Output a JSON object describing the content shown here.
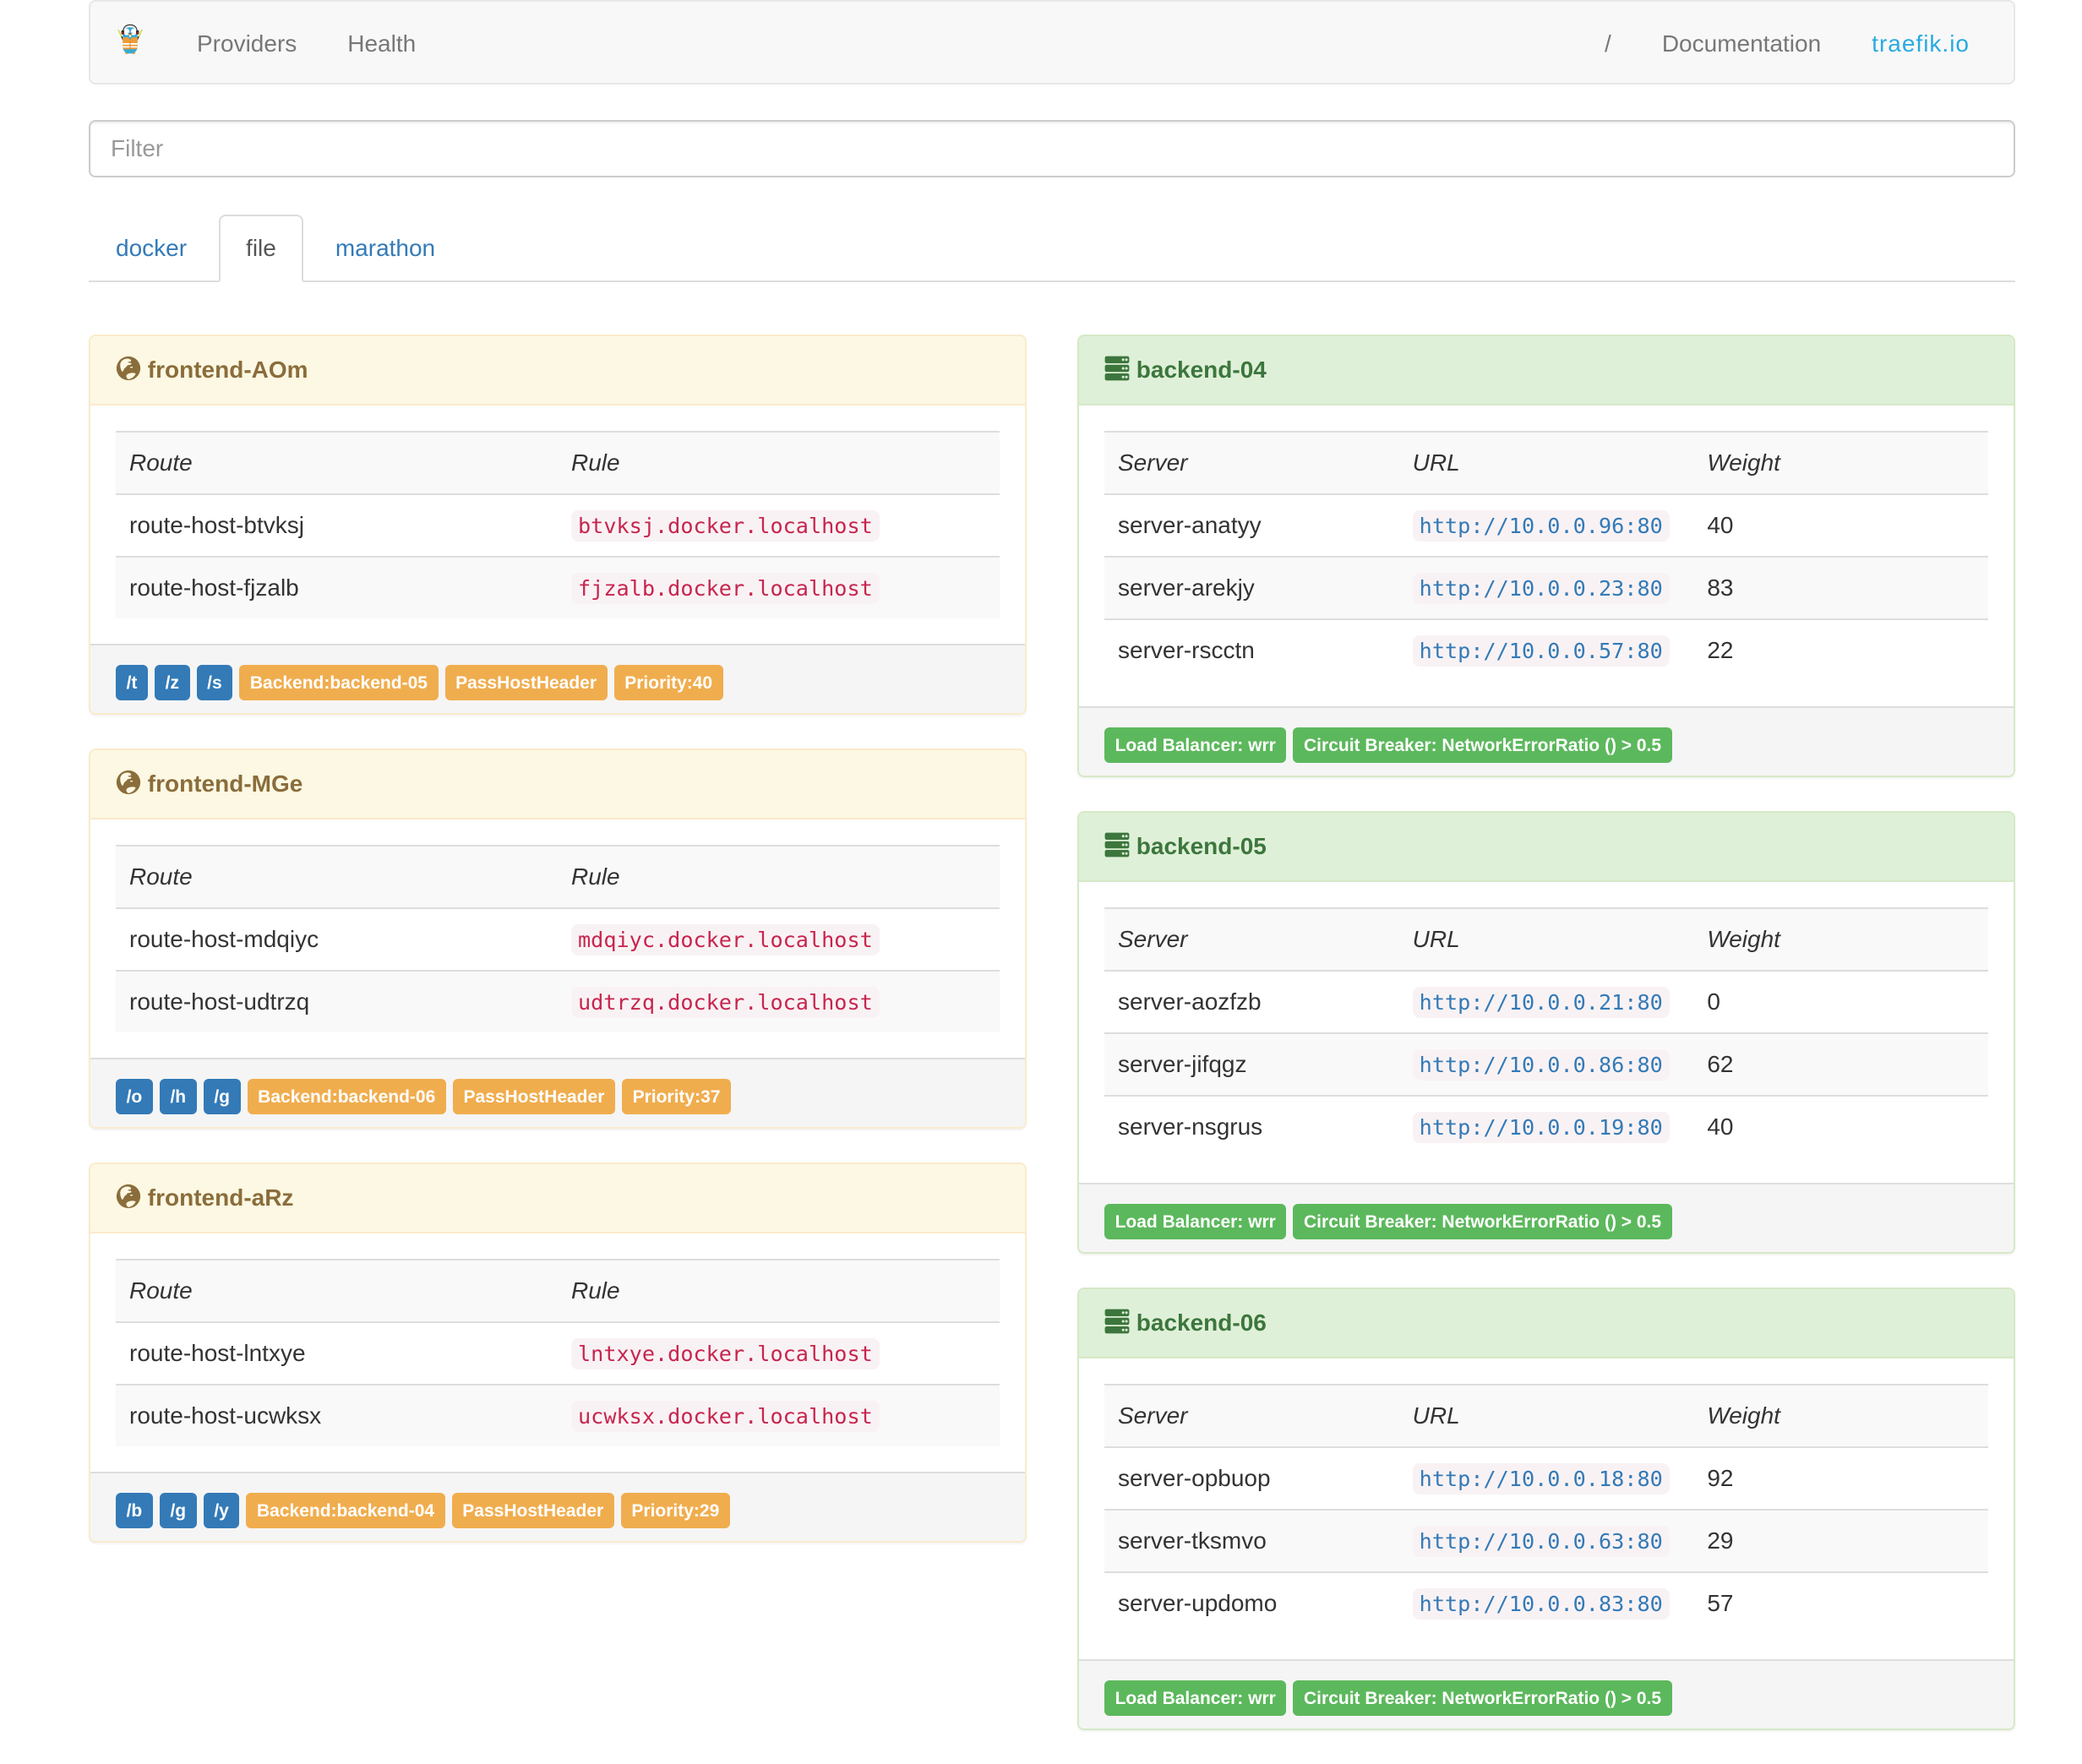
{
  "navbar": {
    "brand_icon": "traefik-gopher-logo",
    "left": [
      "Providers",
      "Health"
    ],
    "right": [
      "/",
      "Documentation",
      "traefik.io"
    ]
  },
  "filter": {
    "placeholder": "Filter"
  },
  "tabs": [
    {
      "label": "docker",
      "active": false
    },
    {
      "label": "file",
      "active": true
    },
    {
      "label": "marathon",
      "active": false
    }
  ],
  "frontend_columns": [
    "Route",
    "Rule"
  ],
  "backend_columns": [
    "Server",
    "URL",
    "Weight"
  ],
  "frontends": [
    {
      "title": "frontend-AOm",
      "routes": [
        {
          "route": "route-host-btvksj",
          "rule": "btvksj.docker.localhost"
        },
        {
          "route": "route-host-fjzalb",
          "rule": "fjzalb.docker.localhost"
        }
      ],
      "entry_badges": [
        "/t",
        "/z",
        "/s"
      ],
      "detail_badges": [
        "Backend:backend-05",
        "PassHostHeader",
        "Priority:40"
      ]
    },
    {
      "title": "frontend-MGe",
      "routes": [
        {
          "route": "route-host-mdqiyc",
          "rule": "mdqiyc.docker.localhost"
        },
        {
          "route": "route-host-udtrzq",
          "rule": "udtrzq.docker.localhost"
        }
      ],
      "entry_badges": [
        "/o",
        "/h",
        "/g"
      ],
      "detail_badges": [
        "Backend:backend-06",
        "PassHostHeader",
        "Priority:37"
      ]
    },
    {
      "title": "frontend-aRz",
      "routes": [
        {
          "route": "route-host-lntxye",
          "rule": "lntxye.docker.localhost"
        },
        {
          "route": "route-host-ucwksx",
          "rule": "ucwksx.docker.localhost"
        }
      ],
      "entry_badges": [
        "/b",
        "/g",
        "/y"
      ],
      "detail_badges": [
        "Backend:backend-04",
        "PassHostHeader",
        "Priority:29"
      ]
    }
  ],
  "backends": [
    {
      "title": "backend-04",
      "servers": [
        {
          "server": "server-anatyy",
          "url": "http://10.0.0.96:80",
          "weight": "40"
        },
        {
          "server": "server-arekjy",
          "url": "http://10.0.0.23:80",
          "weight": "83"
        },
        {
          "server": "server-rscctn",
          "url": "http://10.0.0.57:80",
          "weight": "22"
        }
      ],
      "detail_badges": [
        "Load Balancer: wrr",
        "Circuit Breaker: NetworkErrorRatio () > 0.5"
      ]
    },
    {
      "title": "backend-05",
      "servers": [
        {
          "server": "server-aozfzb",
          "url": "http://10.0.0.21:80",
          "weight": "0"
        },
        {
          "server": "server-jifqgz",
          "url": "http://10.0.0.86:80",
          "weight": "62"
        },
        {
          "server": "server-nsgrus",
          "url": "http://10.0.0.19:80",
          "weight": "40"
        }
      ],
      "detail_badges": [
        "Load Balancer: wrr",
        "Circuit Breaker: NetworkErrorRatio () > 0.5"
      ]
    },
    {
      "title": "backend-06",
      "servers": [
        {
          "server": "server-opbuop",
          "url": "http://10.0.0.18:80",
          "weight": "92"
        },
        {
          "server": "server-tksmvo",
          "url": "http://10.0.0.63:80",
          "weight": "29"
        },
        {
          "server": "server-updomo",
          "url": "http://10.0.0.83:80",
          "weight": "57"
        }
      ],
      "detail_badges": [
        "Load Balancer: wrr",
        "Circuit Breaker: NetworkErrorRatio () > 0.5"
      ]
    }
  ],
  "colors": {
    "traefik_brand": "#29aae1",
    "link_blue": "#337ab7",
    "warning_badge": "#f0ad4e",
    "success_badge": "#5cb85c",
    "frontend_heading_bg": "#fcf8e3",
    "frontend_heading_text": "#8a6d3b",
    "backend_heading_bg": "#dff0d8",
    "backend_heading_text": "#3c763d",
    "code_text": "#c7254e",
    "code_bg": "#f9f2f4"
  }
}
